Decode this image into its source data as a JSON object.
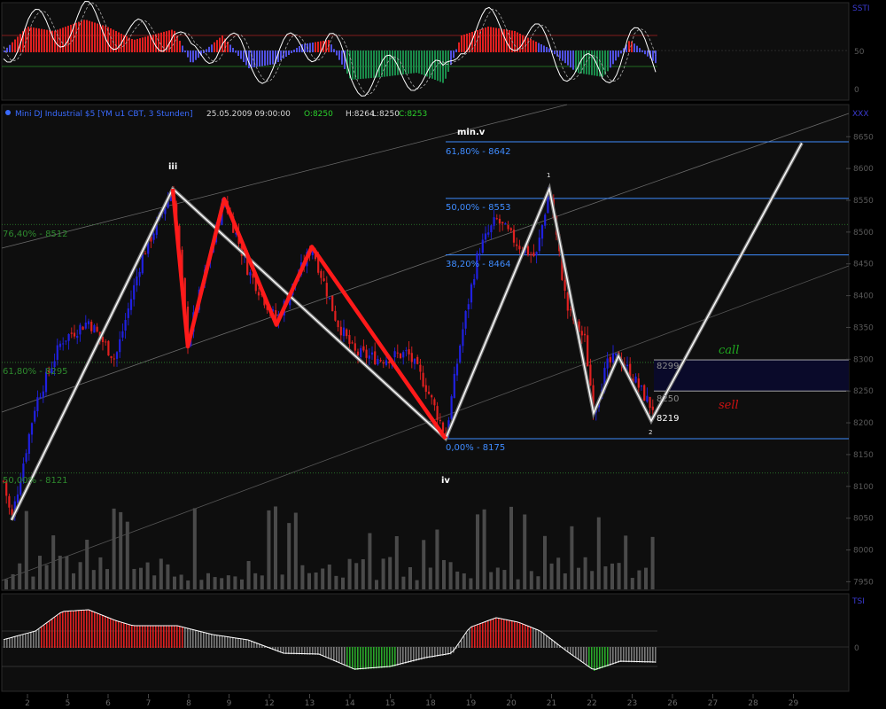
{
  "header": {
    "instrument": "Mini DJ Industrial $5 [YM u1 CBT, 3 Stunden]",
    "datetime": "25.05.2009 09:00:00",
    "open": "O:8250",
    "high": "H:8264",
    "low": "L:8250",
    "close": "C:8253"
  },
  "panels": {
    "top_label": "SSTI",
    "main_label": "XXX",
    "bottom_label": "TSI"
  },
  "labels": {
    "wave_iii": "iii",
    "wave_iv": "iv",
    "wave_minv": "min.v",
    "pt1": "1",
    "pt2": "2",
    "call": "call",
    "sell": "sell",
    "price_8299": "8299",
    "price_8250": "8250",
    "price_8219": "8219"
  },
  "colors": {
    "bull_candle": "#2020e0",
    "bear_candle": "#e02020",
    "wave_red": "#ff1a1a",
    "wave_white": "#ffffff",
    "fib_blue": "#3f8cff",
    "green_level": "#2e8a2e"
  },
  "chart_data": {
    "type": "candlestick",
    "ylim": [
      7950,
      8700
    ],
    "y_ticks": [
      "8650",
      "8600",
      "8550",
      "8500",
      "8450",
      "8400",
      "8350",
      "8300",
      "8250",
      "8200",
      "8150",
      "8100",
      "8050",
      "8000",
      "7950"
    ],
    "x_ticks": [
      "2",
      "5",
      "6",
      "7",
      "8",
      "9",
      "12",
      "13",
      "14",
      "15",
      "18",
      "19",
      "20",
      "21",
      "22",
      "23",
      "26",
      "27",
      "28",
      "29"
    ],
    "fib_levels": [
      {
        "label": "61,80% - 8642",
        "value": 8642
      },
      {
        "label": "50,00% - 8553",
        "value": 8553
      },
      {
        "label": "38,20% - 8464",
        "value": 8464
      },
      {
        "label": "0,00% - 8175",
        "value": 8175
      }
    ],
    "green_levels": [
      {
        "label": "76,40% - 8512",
        "value": 8512
      },
      {
        "label": "61,80% - 8295",
        "value": 8295
      },
      {
        "label": "50,00% - 8121",
        "value": 8121
      }
    ],
    "box_levels": [
      8299,
      8250
    ],
    "red_wave": [
      [
        195,
        8568
      ],
      [
        212,
        8320
      ],
      [
        253,
        8552
      ],
      [
        312,
        8354
      ],
      [
        352,
        8477
      ],
      [
        503,
        8175
      ]
    ],
    "white_path": [
      [
        13,
        8047
      ],
      [
        195,
        8568
      ],
      [
        503,
        8175
      ],
      [
        620,
        8568
      ],
      [
        670,
        8215
      ],
      [
        698,
        8305
      ],
      [
        735,
        8203
      ],
      [
        905,
        8640
      ]
    ],
    "top_scale": [
      "50",
      "0"
    ],
    "bottom_scale": [
      "0"
    ]
  }
}
